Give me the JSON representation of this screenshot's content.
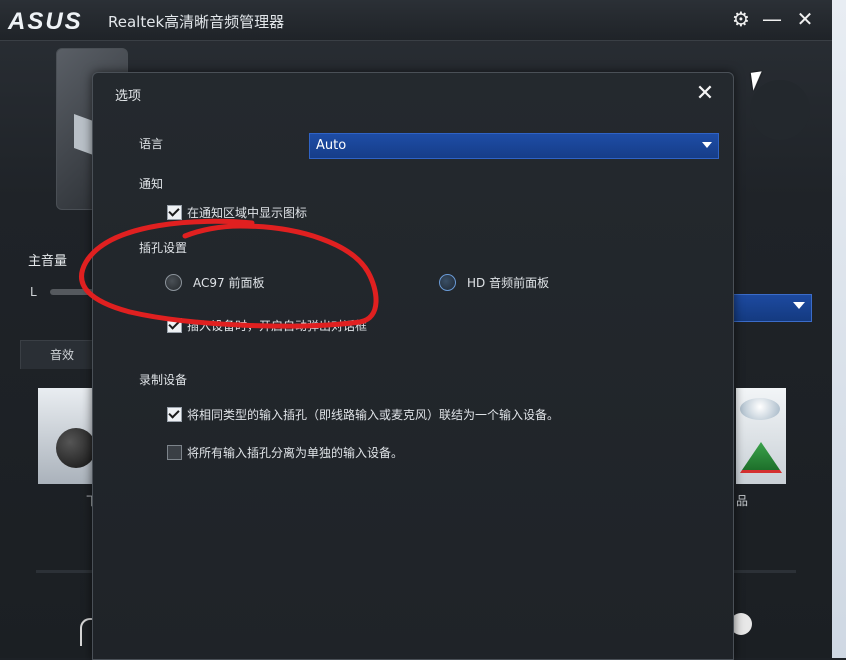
{
  "app": {
    "logo": "ASUS",
    "title": "Realtek高清晰音频管理器"
  },
  "titlebar": {
    "settings_icon": "gear-icon",
    "minimize_icon": "minimize-icon",
    "close_icon": "close-icon",
    "minimize_glyph": "—",
    "close_glyph": "✕",
    "settings_glyph": "⚙"
  },
  "background": {
    "volume_label": "主音量",
    "l_label": "L",
    "tab_label": "音效",
    "caption_left": "下",
    "caption_right": "品"
  },
  "dialog": {
    "title": "选项",
    "close_glyph": "✕",
    "language_label": "语言",
    "language_value": "Auto",
    "notify_label": "通知",
    "notify_checkbox_label": "在通知区域中显示图标",
    "jack_label": "插孔设置",
    "jack_option_ac97": "AC97 前面板",
    "jack_option_hd": "HD 音频前面板",
    "jack_checkbox_label": "插入设备时，开启自动弹出对话框",
    "recording_label": "录制设备",
    "recording_option_1": "将相同类型的输入插孔（即线路输入或麦克风）联结为一个输入设备。",
    "recording_option_2": "将所有输入插孔分离为单独的输入设备。"
  },
  "colors": {
    "select_blue": "#1e4da6",
    "annotation_red": "#e02020",
    "dialog_bg": "#24292e"
  }
}
